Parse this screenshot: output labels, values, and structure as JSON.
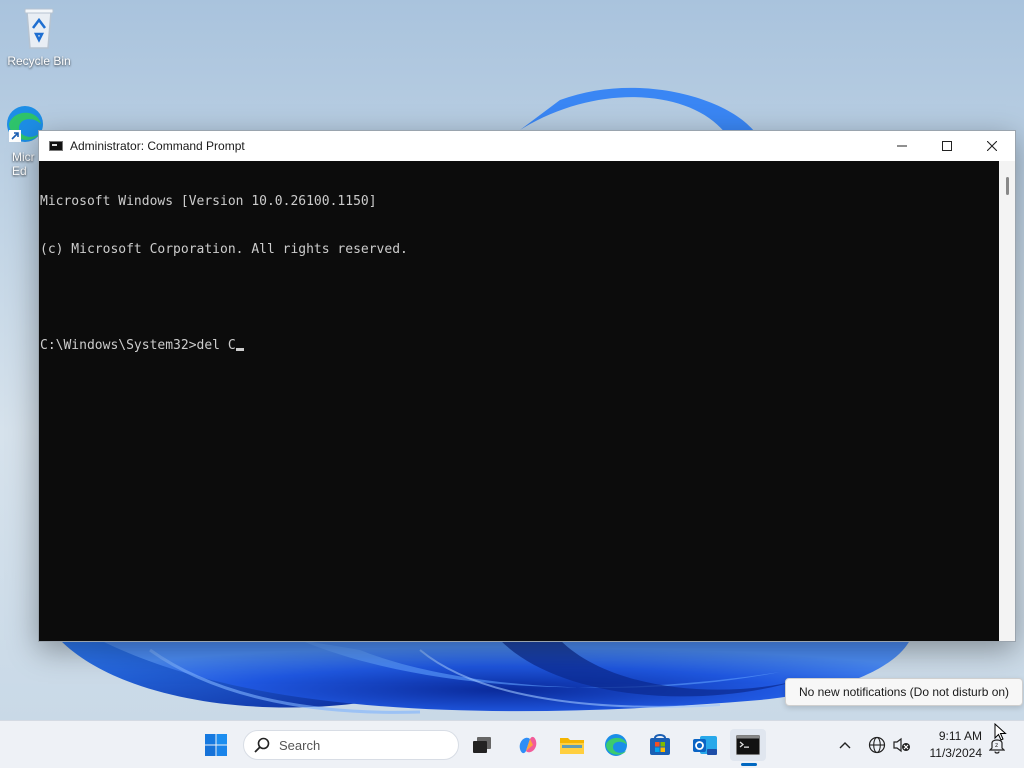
{
  "desktop": {
    "icons": [
      {
        "label": "Recycle Bin",
        "icon": "recycle-bin-icon"
      },
      {
        "label": "Micr\nEd",
        "icon": "edge-icon"
      }
    ]
  },
  "window": {
    "title": "Administrator: Command Prompt",
    "controls": {
      "minimize": "—",
      "maximize": "☐",
      "close": "✕"
    },
    "terminal_lines": [
      "Microsoft Windows [Version 10.0.26100.1150]",
      "(c) Microsoft Corporation. All rights reserved.",
      "",
      "C:\\Windows\\System32>del C"
    ]
  },
  "toast": {
    "text": "No new notifications (Do not disturb on)"
  },
  "taskbar": {
    "search": {
      "placeholder": "Search"
    },
    "pinned": [
      {
        "name": "start",
        "icon": "windows-start-icon"
      },
      {
        "name": "task-view",
        "icon": "task-view-icon"
      },
      {
        "name": "copilot",
        "icon": "copilot-icon"
      },
      {
        "name": "file-explorer",
        "icon": "folder-icon"
      },
      {
        "name": "edge",
        "icon": "edge-icon"
      },
      {
        "name": "store",
        "icon": "store-icon"
      },
      {
        "name": "outlook",
        "icon": "outlook-icon"
      },
      {
        "name": "command-prompt",
        "icon": "terminal-icon",
        "active": true
      }
    ],
    "tray": {
      "time": "9:11 AM",
      "date": "11/3/2024"
    }
  },
  "colors": {
    "terminal_bg": "#0c0c0c",
    "terminal_fg": "#cccccc",
    "accent": "#0067c0"
  }
}
